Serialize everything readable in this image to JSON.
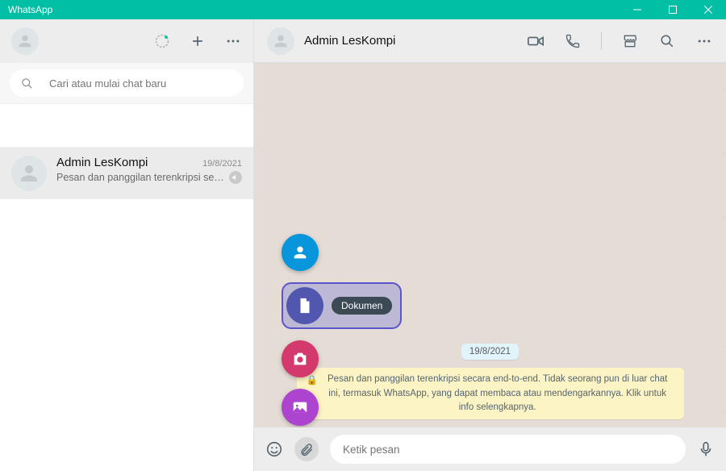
{
  "window": {
    "title": "WhatsApp"
  },
  "sidebar": {
    "search_placeholder": "Cari atau mulai chat baru",
    "chats": [
      {
        "name": "Admin LesKompi",
        "date": "19/8/2021",
        "preview": "Pesan dan panggilan terenkripsi secara ..."
      }
    ]
  },
  "chat": {
    "title": "Admin LesKompi",
    "date_chip": "19/8/2021",
    "encryption_notice": "Pesan dan panggilan terenkripsi secara end-to-end. Tidak seorang pun di luar chat ini, termasuk WhatsApp, yang dapat membaca atau mendengarkannya. Klik untuk info selengkapnya."
  },
  "attach_menu": {
    "document_label": "Dokumen"
  },
  "composer": {
    "placeholder": "Ketik pesan"
  }
}
